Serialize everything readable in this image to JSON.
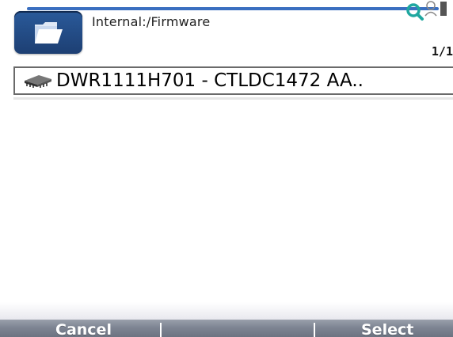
{
  "header": {
    "path": "Internal:/Firmware",
    "page_counter": "1/1",
    "accent_color": "#3a6fc0",
    "folder_icon": "folder-open-icon",
    "search_icon": "search-icon",
    "user_icon": "user-icon"
  },
  "list": {
    "items": [
      {
        "label": "DWR1111H701 - CTLDC1472 AA..",
        "icon": "chip-icon"
      }
    ]
  },
  "softkeys": {
    "left": "Cancel",
    "right": "Select"
  }
}
